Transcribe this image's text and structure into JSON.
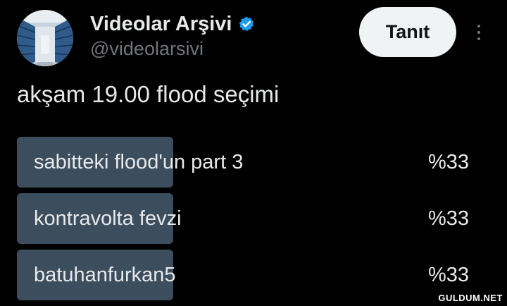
{
  "author": {
    "display_name": "Videolar Arşivi",
    "handle": "@videolarsivi",
    "verified": true,
    "verified_color": "#1d9bf0"
  },
  "follow_button": {
    "label": "Tanıt"
  },
  "tweet": {
    "text": "akşam 19.00 flood seçimi"
  },
  "poll": {
    "bar_color": "#3c4e5e",
    "options": [
      {
        "label": "sabitteki flood'un part 3",
        "percent_label": "%33",
        "percent": 33
      },
      {
        "label": "kontravolta fevzi",
        "percent_label": "%33",
        "percent": 33
      },
      {
        "label": "batuhanfurkan5",
        "percent_label": "%33",
        "percent": 33
      }
    ]
  },
  "watermark": {
    "text": "GULDUM.NET"
  }
}
